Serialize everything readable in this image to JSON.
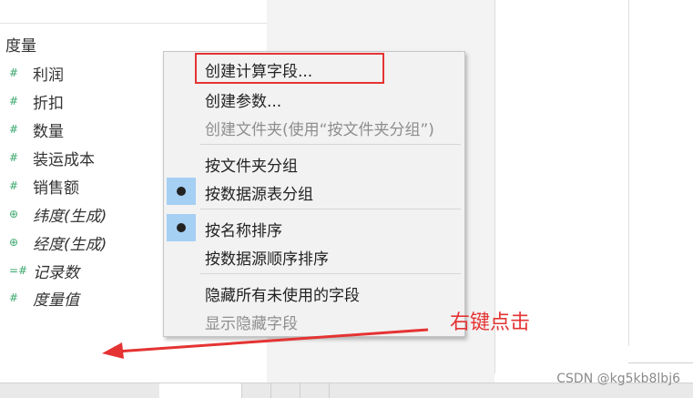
{
  "data_pane": {
    "section_header": "度量",
    "fields": [
      {
        "label": "利润",
        "icon": "hash-icon",
        "italic": false
      },
      {
        "label": "折扣",
        "icon": "hash-icon",
        "italic": false
      },
      {
        "label": "数量",
        "icon": "hash-icon",
        "italic": false
      },
      {
        "label": "装运成本",
        "icon": "hash-icon",
        "italic": false
      },
      {
        "label": "销售额",
        "icon": "hash-icon",
        "italic": false
      },
      {
        "label": "纬度(生成)",
        "icon": "globe-icon",
        "italic": true
      },
      {
        "label": "经度(生成)",
        "icon": "globe-icon",
        "italic": true
      },
      {
        "label": "记录数",
        "icon": "record-count-icon",
        "italic": true
      },
      {
        "label": "度量值",
        "icon": "hash-icon",
        "italic": true
      }
    ]
  },
  "context_menu": {
    "items": [
      {
        "label": "创建计算字段...",
        "enabled": true,
        "checked": false,
        "highlighted": true
      },
      {
        "label": "创建参数...",
        "enabled": true,
        "checked": false
      },
      {
        "label": "创建文件夹(使用“按文件夹分组”)",
        "enabled": false,
        "checked": false
      },
      {
        "label": "按文件夹分组",
        "enabled": true,
        "checked": false
      },
      {
        "label": "按数据源表分组",
        "enabled": true,
        "checked": true
      },
      {
        "label": "按名称排序",
        "enabled": true,
        "checked": true
      },
      {
        "label": "按数据源顺序排序",
        "enabled": true,
        "checked": false
      },
      {
        "label": "隐藏所有未使用的字段",
        "enabled": true,
        "checked": false
      },
      {
        "label": "显示隐藏字段",
        "enabled": false,
        "checked": false
      }
    ]
  },
  "annotation": {
    "text": "右键点击",
    "color": "#e53333"
  },
  "watermark": "CSDN @kg5kb8lbj6",
  "colors": {
    "field_icon": "#3aa76d",
    "check_bg": "#a6cff4",
    "highlight_border": "#e53333"
  }
}
